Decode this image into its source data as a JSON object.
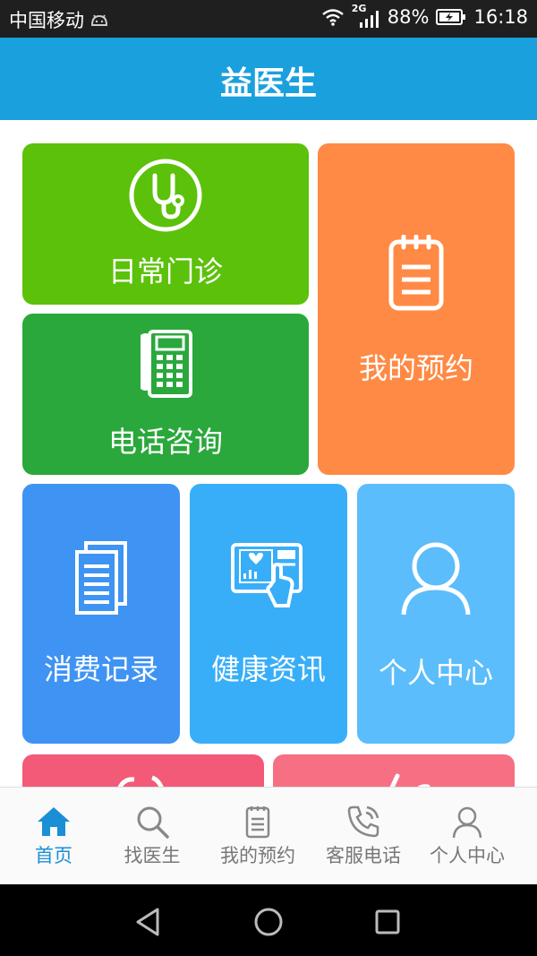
{
  "status_bar": {
    "carrier": "中国移动",
    "network": "2G",
    "battery": "88%",
    "time": "16:18"
  },
  "header": {
    "title": "益医生"
  },
  "tiles": {
    "clinic": {
      "label": "日常门诊",
      "color": "#5cc10a"
    },
    "phone": {
      "label": "电话咨询",
      "color": "#2aa83c"
    },
    "booking": {
      "label": "我的预约",
      "color": "#ff8a45"
    },
    "records": {
      "label": "消费记录",
      "color": "#3f93f3"
    },
    "news": {
      "label": "健康资讯",
      "color": "#38aef8"
    },
    "profile": {
      "label": "个人中心",
      "color": "#5bbdfb"
    },
    "partial_left": {
      "color": "#f25a78"
    },
    "partial_right": {
      "color": "#f76f83"
    }
  },
  "bottom_nav": {
    "items": [
      {
        "label": "首页",
        "icon": "home-icon",
        "active": true
      },
      {
        "label": "找医生",
        "icon": "search-icon",
        "active": false
      },
      {
        "label": "我的预约",
        "icon": "clipboard-icon",
        "active": false
      },
      {
        "label": "客服电话",
        "icon": "phone-icon",
        "active": false
      },
      {
        "label": "个人中心",
        "icon": "user-icon",
        "active": false
      }
    ],
    "active_color": "#1a8fd6",
    "inactive_color": "#777777"
  }
}
